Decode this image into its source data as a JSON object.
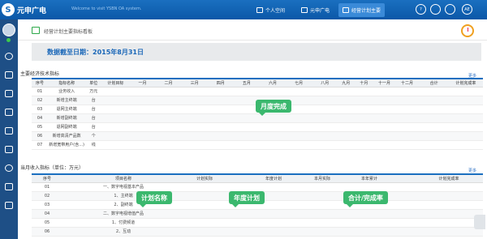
{
  "app": {
    "logo_text": "元申广电",
    "logo_glyph": "S",
    "welcome": "Welcome to visit YSBN OA system."
  },
  "topnav": {
    "tabs": [
      {
        "label": "个人空间",
        "icon": "home-icon"
      },
      {
        "label": "元申广电",
        "icon": "building-icon"
      },
      {
        "label": "经营计划主要",
        "icon": "chart-icon"
      }
    ],
    "active_tab": 2,
    "right_icons": [
      "help-icon",
      "user-icon",
      "mail-icon",
      "settings-icon"
    ],
    "right_labels": [
      "?",
      "",
      "",
      "AE"
    ]
  },
  "sidebar": {
    "icons": [
      "add-icon",
      "calendar-icon",
      "table-icon",
      "flow-icon",
      "home-icon",
      "grid-icon",
      "target-icon",
      "briefcase-icon",
      "document-icon"
    ]
  },
  "page": {
    "title": "经营计划主要指标看板",
    "date_label": "数据截至日期：2015年8月31日",
    "section1_title": "主要经济技术指标",
    "section2_title": "当月收入指标（单位：万元）",
    "more_label": "更多"
  },
  "table1": {
    "headers": [
      "序号",
      "指标名称",
      "单位",
      "计划目标",
      "一月",
      "二月",
      "三月",
      "四月",
      "五月",
      "六月",
      "七月",
      "八月",
      "九月",
      "十月",
      "十一月",
      "十二月",
      "合计",
      "计划完成率"
    ],
    "rows": [
      {
        "no": "01",
        "name": "业务收入",
        "unit": "万元"
      },
      {
        "no": "02",
        "name": "新增主终端",
        "unit": "台"
      },
      {
        "no": "03",
        "name": "退网主终端",
        "unit": "台"
      },
      {
        "no": "04",
        "name": "新增副终端",
        "unit": "台"
      },
      {
        "no": "05",
        "name": "退网副终端",
        "unit": "台"
      },
      {
        "no": "06",
        "name": "新增高清产品数",
        "unit": "个"
      },
      {
        "no": "07",
        "name": "新增宽带用户(含...)",
        "unit": "线"
      }
    ]
  },
  "table2": {
    "headers": [
      "序号",
      "项目名称",
      "计划实际",
      "",
      "年度计划",
      "本月实际",
      "本年累计",
      "",
      "计划完成率"
    ],
    "rows": [
      {
        "no": "01",
        "name": "一、数字电视基本产品"
      },
      {
        "no": "02",
        "name": "1、主终端"
      },
      {
        "no": "03",
        "name": "2、副终端"
      },
      {
        "no": "04",
        "name": "二、数字电视增值产品"
      },
      {
        "no": "05",
        "name": "1、付费频道"
      },
      {
        "no": "06",
        "name": "2、互动"
      }
    ]
  },
  "callouts": {
    "monthly": "月度完成",
    "plan_name": "计划名称",
    "annual_plan": "年度计划",
    "total_rate": "合计/完成率"
  },
  "colors": {
    "topbar": "#0b58a8",
    "sidebar": "#1e4f86",
    "accent": "#1a6fc0",
    "callout": "#3bb86e",
    "date_text": "#1a67b8"
  }
}
